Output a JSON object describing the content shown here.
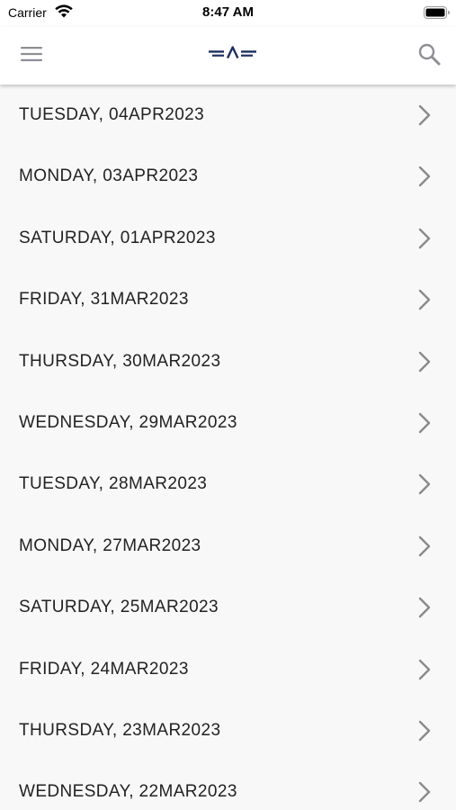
{
  "status_bar": {
    "carrier": "Carrier",
    "time": "8:47 AM"
  },
  "nav": {
    "menu_icon": "hamburger-menu-icon",
    "logo_icon": "app-logo-icon",
    "search_icon": "search-icon",
    "logo_color": "#1d2f5e",
    "icon_color": "#8e8e93"
  },
  "dates": [
    "TUESDAY, 04APR2023",
    "MONDAY, 03APR2023",
    "SATURDAY, 01APR2023",
    "FRIDAY, 31MAR2023",
    "THURSDAY, 30MAR2023",
    "WEDNESDAY, 29MAR2023",
    "TUESDAY, 28MAR2023",
    "MONDAY, 27MAR2023",
    "SATURDAY, 25MAR2023",
    "FRIDAY, 24MAR2023",
    "THURSDAY, 23MAR2023",
    "WEDNESDAY, 22MAR2023"
  ],
  "colors": {
    "background": "#f8f8f8",
    "text": "#222222",
    "chevron": "#8a8a8a"
  }
}
